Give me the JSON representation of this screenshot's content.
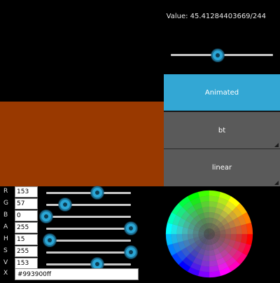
{
  "value_label": "Value: 45.41284403669/244",
  "top_slider": {
    "value_fraction": 0.46
  },
  "buttons": [
    {
      "label": "Animated",
      "active": true
    },
    {
      "label": "bt",
      "active": false
    },
    {
      "label": "linear",
      "active": false
    }
  ],
  "preview_color": "#993900",
  "channels": [
    {
      "label": "R",
      "value": "153",
      "fraction": 0.6
    },
    {
      "label": "G",
      "value": "57",
      "fraction": 0.22
    },
    {
      "label": "B",
      "value": "0",
      "fraction": 0.0
    },
    {
      "label": "A",
      "value": "255",
      "fraction": 1.0
    },
    {
      "label": "H",
      "value": "15",
      "fraction": 0.04
    },
    {
      "label": "S",
      "value": "255",
      "fraction": 1.0
    },
    {
      "label": "V",
      "value": "153",
      "fraction": 0.6
    }
  ],
  "hex": {
    "label": "X",
    "value": "#993900ff"
  },
  "colors": {
    "accent": "#2aa6d6",
    "button_active": "#33a7d4",
    "button_normal": "#5a5a5a"
  }
}
